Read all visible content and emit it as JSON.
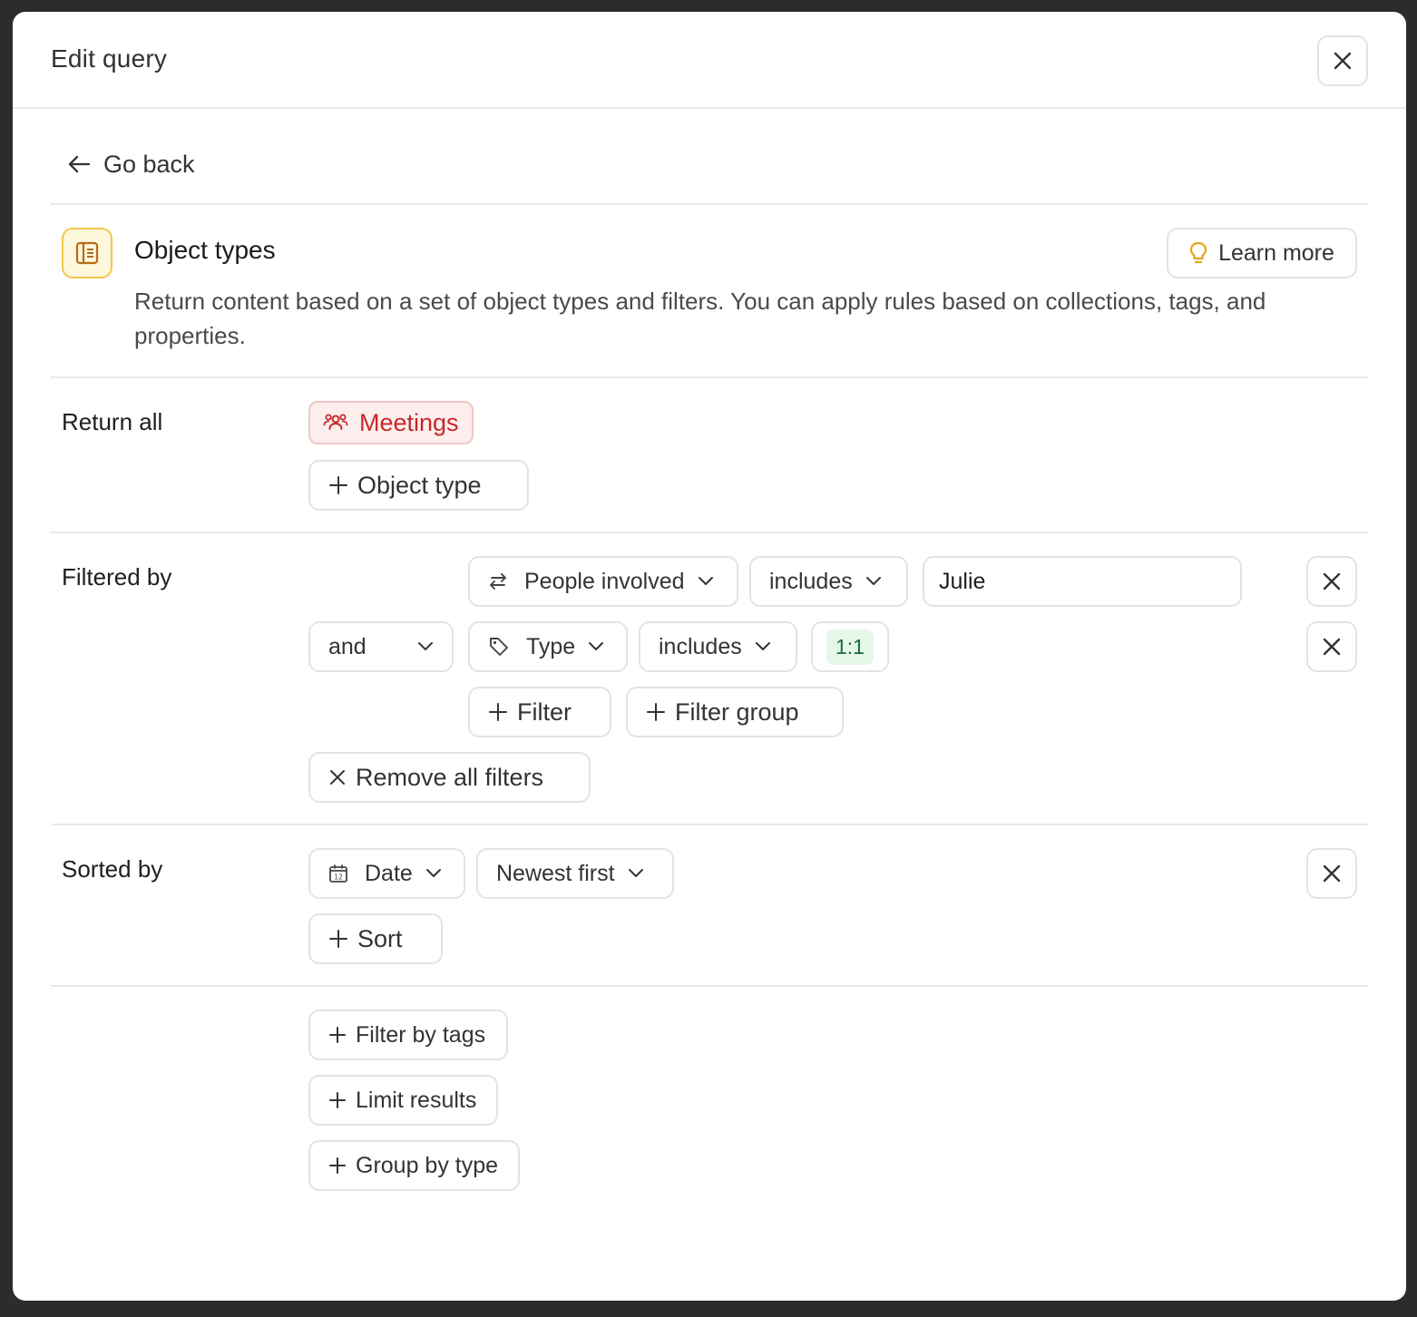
{
  "modal": {
    "title": "Edit query",
    "go_back_label": "Go back"
  },
  "object_types": {
    "title": "Object types",
    "description": "Return content based on a set of object types and filters. You can apply rules based on collections, tags, and properties.",
    "learn_more_label": "Learn more"
  },
  "return_all": {
    "label": "Return all",
    "chip_label": "Meetings",
    "add_label": "Object type"
  },
  "filtered_by": {
    "label": "Filtered by",
    "rows": [
      {
        "conjunction": "",
        "property": "People involved",
        "operator": "includes",
        "value": "Julie"
      },
      {
        "conjunction": "and",
        "property": "Type",
        "operator": "includes",
        "value": "1:1"
      }
    ],
    "add_filter_label": "Filter",
    "add_filter_group_label": "Filter group",
    "remove_all_label": "Remove all filters"
  },
  "sorted_by": {
    "label": "Sorted by",
    "property": "Date",
    "direction": "Newest first",
    "add_sort_label": "Sort"
  },
  "extras": {
    "filter_by_tags_label": "Filter by tags",
    "limit_results_label": "Limit results",
    "group_by_type_label": "Group by type"
  },
  "colors": {
    "meetings_chip_text": "#c62828",
    "meetings_chip_bg": "#fdeeee",
    "value_chip_bg": "#e4f7e9",
    "value_chip_text": "#1d6b37",
    "object_icon_border": "#f2c84b",
    "object_icon_fill": "#fdf7dc",
    "learn_more_icon": "#e8a317"
  },
  "icons": {
    "close": "close-icon",
    "back": "arrow-left-icon",
    "object_types": "document-icon",
    "learn_more": "lightbulb-icon",
    "meetings": "people-group-icon",
    "people_involved": "arrows-swap-icon",
    "type": "tag-icon",
    "date": "calendar-icon",
    "chevron": "chevron-down-icon",
    "add": "plus-icon",
    "remove": "x-icon"
  }
}
